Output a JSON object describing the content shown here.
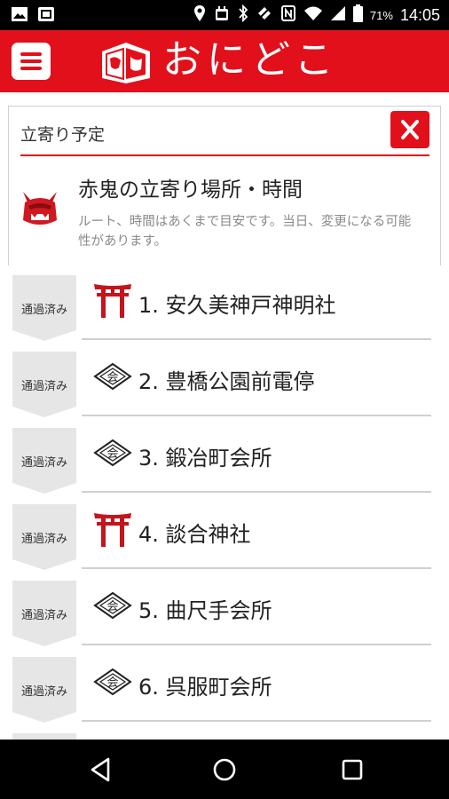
{
  "status_bar": {
    "battery_percent": "71%",
    "time": "14:05",
    "left_icons": [
      "image-icon",
      "gallery-icon"
    ],
    "right_icons": [
      "location-icon",
      "android-robot-icon",
      "bluetooth-icon",
      "mute-icon",
      "nfc-icon",
      "wifi-icon",
      "signal-icon",
      "battery-icon"
    ]
  },
  "header": {
    "title": "おにどこ",
    "menu_icon": "hamburger-menu-icon",
    "logo": "onidoko-logo"
  },
  "panel": {
    "title": "立寄り予定",
    "close_icon": "close-icon",
    "heading": "赤鬼の立寄り場所・時間",
    "note": "ルート、時間はあくまで目安です。当日、変更になる可能性があります。"
  },
  "route": {
    "stops": [
      {
        "status": "通過済み",
        "name": "1. 安久美神戸神明社",
        "icon": "torii-icon"
      },
      {
        "status": "通過済み",
        "name": "2. 豊橋公園前電停",
        "icon": "kai-diamond-icon"
      },
      {
        "status": "通過済み",
        "name": "3. 鍛冶町会所",
        "icon": "kai-diamond-icon"
      },
      {
        "status": "通過済み",
        "name": "4. 談合神社",
        "icon": "torii-icon"
      },
      {
        "status": "通過済み",
        "name": "5. 曲尺手会所",
        "icon": "kai-diamond-icon"
      },
      {
        "status": "通過済み",
        "name": "6. 呉服町会所",
        "icon": "kai-diamond-icon"
      }
    ]
  },
  "colors": {
    "accent": "#e2101b",
    "chevron": "#e6e6e6",
    "divider": "#d0d0d0"
  }
}
